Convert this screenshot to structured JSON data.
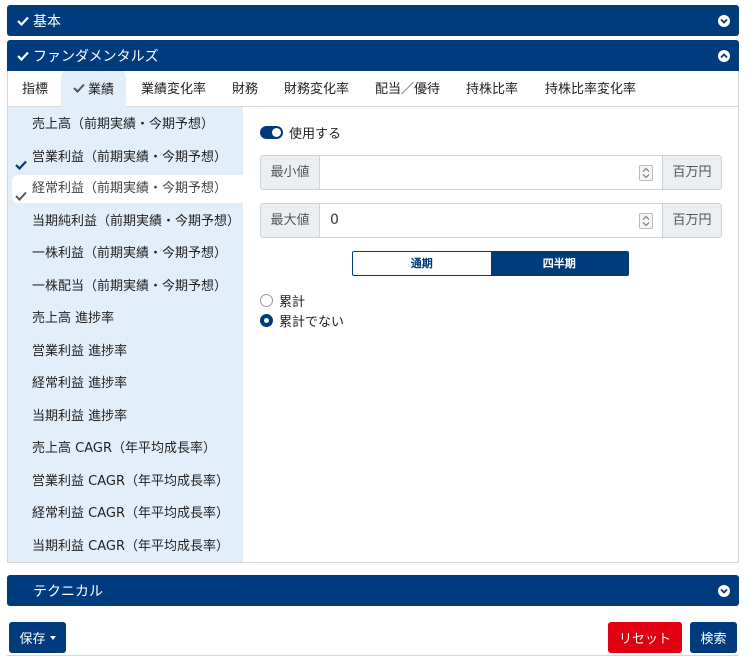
{
  "sections": {
    "basic": {
      "label": "基本"
    },
    "fundamentals": {
      "label": "ファンダメンタルズ"
    },
    "technical": {
      "label": "テクニカル"
    }
  },
  "tabs": [
    {
      "label": "指標"
    },
    {
      "label": "業績"
    },
    {
      "label": "業績変化率"
    },
    {
      "label": "財務"
    },
    {
      "label": "財務変化率"
    },
    {
      "label": "配当／優待"
    },
    {
      "label": "持株比率"
    },
    {
      "label": "持株比率変化率"
    }
  ],
  "sidebar": {
    "items": [
      {
        "label": "売上高（前期実績・今期予想）"
      },
      {
        "label": "営業利益（前期実績・今期予想）"
      },
      {
        "label": "経常利益（前期実績・今期予想）"
      },
      {
        "label": "当期純利益（前期実績・今期予想）"
      },
      {
        "label": "一株利益（前期実績・今期予想）"
      },
      {
        "label": "一株配当（前期実績・今期予想）"
      },
      {
        "label": "売上高  進捗率"
      },
      {
        "label": "営業利益  進捗率"
      },
      {
        "label": "経常利益  進捗率"
      },
      {
        "label": "当期利益  進捗率"
      },
      {
        "label": "売上高  CAGR（年平均成長率）"
      },
      {
        "label": "営業利益  CAGR（年平均成長率）"
      },
      {
        "label": "経常利益  CAGR（年平均成長率）"
      },
      {
        "label": "当期利益  CAGR（年平均成長率）"
      }
    ]
  },
  "form": {
    "use_label": "使用する",
    "min": {
      "label": "最小値",
      "value": "",
      "unit": "百万円"
    },
    "max": {
      "label": "最大値",
      "value": "0",
      "unit": "百万円"
    },
    "period": {
      "annual": "通期",
      "quarterly": "四半期"
    },
    "radio": {
      "cumulative": "累計",
      "non_cumulative": "累計でない"
    }
  },
  "footer": {
    "save": "保存",
    "reset": "リセット",
    "search": "検索"
  },
  "colors": {
    "primary": "#003c7d",
    "danger": "#e00012",
    "sidebar_bg": "#e3eefb"
  }
}
